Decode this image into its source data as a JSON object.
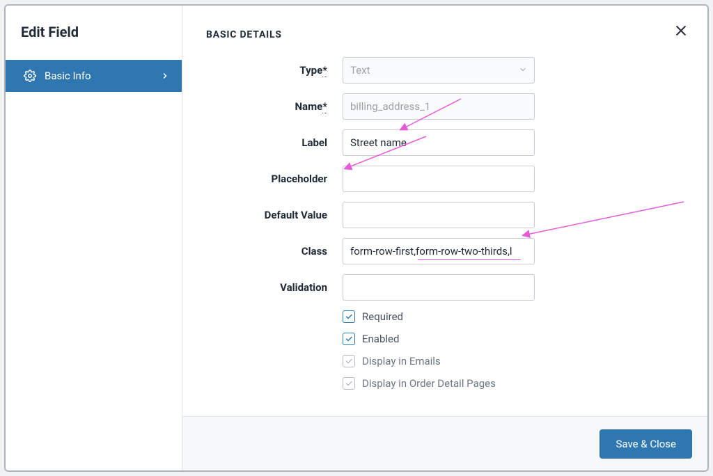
{
  "modal": {
    "title": "Edit Field",
    "close_label": "×"
  },
  "sidebar": {
    "items": [
      {
        "label": "Basic Info"
      }
    ]
  },
  "section": {
    "title": "BASIC DETAILS"
  },
  "form": {
    "type": {
      "label": "Type",
      "required": true,
      "value": "Text",
      "disabled": true
    },
    "name": {
      "label": "Name",
      "required": true,
      "value": "billing_address_1",
      "disabled": true
    },
    "labelField": {
      "label": "Label",
      "value": "Street name"
    },
    "placeholder": {
      "label": "Placeholder",
      "value": ""
    },
    "default": {
      "label": "Default Value",
      "value": ""
    },
    "class": {
      "label": "Class",
      "value": "form-row-first,form-row-two-thirds,l"
    },
    "validation": {
      "label": "Validation",
      "value": ""
    }
  },
  "checks": {
    "required": {
      "label": "Required",
      "checked": true,
      "locked": false
    },
    "enabled": {
      "label": "Enabled",
      "checked": true,
      "locked": false
    },
    "emails": {
      "label": "Display in Emails",
      "checked": true,
      "locked": true
    },
    "order_detail": {
      "label": "Display in Order Detail Pages",
      "checked": true,
      "locked": true
    }
  },
  "footer": {
    "save_label": "Save & Close"
  },
  "required_marker": "*"
}
